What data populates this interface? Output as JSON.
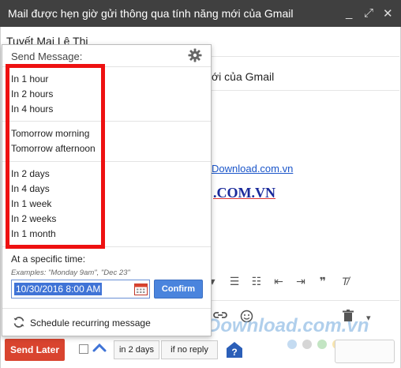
{
  "window": {
    "title": "Mail được hẹn giờ gửi thông qua tính năng mới của Gmail",
    "minimize_glyph": "_",
    "expand_glyph": "⤢",
    "close_glyph": "✕"
  },
  "compose": {
    "to_text": "Tuyết Mai Lê Thị",
    "subject_tail": "ới của Gmail",
    "body_link": "Download.com.vn",
    "body_big": ".COM.VN"
  },
  "popup": {
    "header": "Send Message:",
    "groups": [
      [
        "In 1 hour",
        "In 2 hours",
        "In 4 hours"
      ],
      [
        "Tomorrow morning",
        "Tomorrow afternoon"
      ],
      [
        "In 2 days",
        "In 4 days",
        "In 1 week",
        "In 2 weeks",
        "In 1 month"
      ]
    ],
    "specific_label": "At a specific time:",
    "examples": "Examples: \"Monday 9am\", \"Dec 23\"",
    "datetime_value": "10/30/2016 8:00 AM",
    "confirm_label": "Confirm",
    "recurring_label": "Schedule recurring message"
  },
  "bottom_bar": {
    "send_later_label": "Send Later",
    "days_label": "in 2 days",
    "reply_label": "if no reply"
  },
  "watermark": "Download.com.vn",
  "colors": {
    "titlebar": "#404040",
    "send_later": "#d9442f",
    "confirm": "#4a84dd",
    "annotation": "#ee1111"
  }
}
